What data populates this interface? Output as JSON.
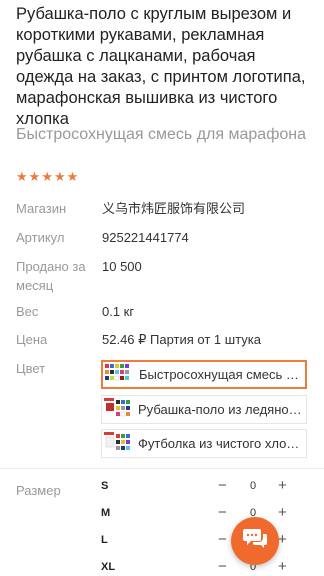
{
  "product": {
    "title": "Рубашка-поло с круглым вырезом и короткими рукавами, рекламная рубашка с лацканами, рабочая одежда на заказ, с принтом логотипа, марафонская вышивка из чистого хлопка",
    "subtitle": "Быстросохнущая смесь для марафона",
    "rating_stars": 5
  },
  "details": {
    "store_label": "Магазин",
    "store_value": "义乌市炜匠服饰有限公司",
    "article_label": "Артикул",
    "article_value": "925221441774",
    "sold_label": "Продано за месяц",
    "sold_value": "10 500",
    "weight_label": "Вес",
    "weight_value": "0.1 кг",
    "price_label": "Цена",
    "price_value": "52.46 ₽ Партия от 1 штука"
  },
  "color": {
    "label": "Цвет",
    "options": [
      {
        "label": "Быстросохнущая смесь для марафона",
        "selected": true
      },
      {
        "label": "Рубашка-поло из ледяного шелка",
        "selected": false
      },
      {
        "label": "Футболка из чистого хлопка",
        "selected": false
      }
    ]
  },
  "size": {
    "label": "Размер",
    "rows": [
      {
        "size": "S",
        "minus": "−",
        "qty": "0",
        "plus": "+"
      },
      {
        "size": "M",
        "minus": "−",
        "qty": "0",
        "plus": "+"
      },
      {
        "size": "L",
        "minus": "−",
        "qty": "0",
        "plus": "+"
      },
      {
        "size": "XL",
        "minus": "−",
        "qty": "0",
        "plus": "+"
      }
    ]
  },
  "colors": {
    "accent": "#f07a3a",
    "fab": "#f06a2d"
  },
  "icons": {
    "chat": "chat-bubbles-icon",
    "star": "star-icon"
  }
}
